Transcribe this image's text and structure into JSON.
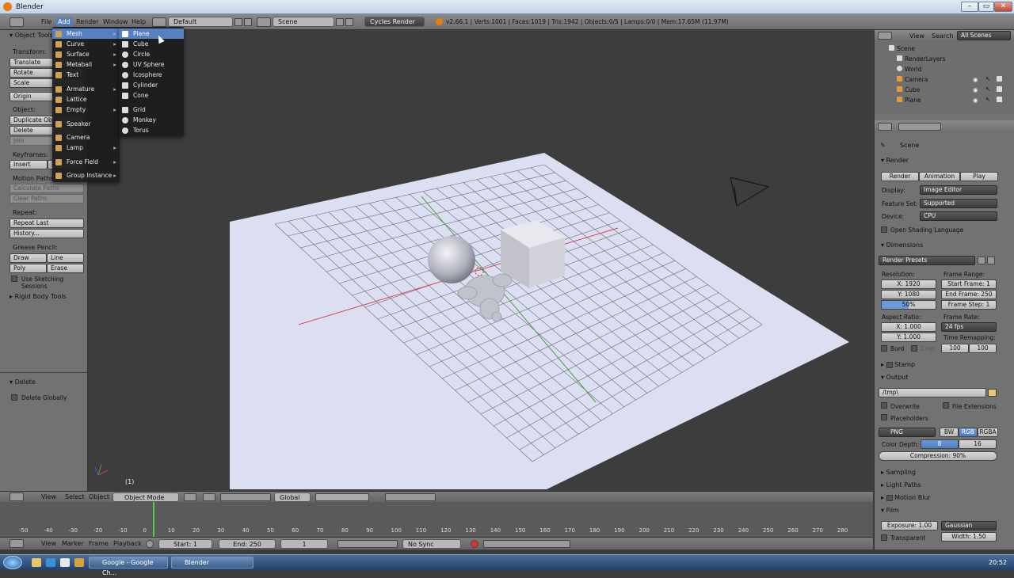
{
  "window": {
    "title": "Blender"
  },
  "topbar": {
    "menus": [
      "File",
      "Add",
      "Render",
      "Window",
      "Help"
    ],
    "layout": "Default",
    "scene": "Scene",
    "engine": "Cycles Render",
    "stats": "v2.66.1 | Verts:1001 | Faces:1019 | Tris:1942 | Objects:0/5 | Lamps:0/0 | Mem:17.65M (11.97M)"
  },
  "add_menu": {
    "items": [
      "Mesh",
      "Curve",
      "Surface",
      "Metaball",
      "Text",
      "Armature",
      "Lattice",
      "Empty",
      "Speaker",
      "Camera",
      "Lamp",
      "Force Field",
      "Group Instance"
    ]
  },
  "mesh_menu": {
    "items": [
      "Plane",
      "Cube",
      "Circle",
      "UV Sphere",
      "Icosphere",
      "Cylinder",
      "Cone",
      "Grid",
      "Monkey",
      "Torus"
    ]
  },
  "tool_shelf": {
    "header": "Object Tools",
    "transform_label": "Transform:",
    "translate": "Translate",
    "rotate": "Rotate",
    "scale": "Scale",
    "origin": "Origin",
    "object_label": "Object:",
    "duplicate": "Duplicate Objec",
    "delete": "Delete",
    "join": "Join",
    "keyframes_label": "Keyframes:",
    "insert": "Insert",
    "insert_r": "R",
    "motion_label": "Motion Paths:",
    "calc_paths": "Calculate Paths",
    "clear_paths": "Clear Paths",
    "repeat_label": "Repeat:",
    "repeat_last": "Repeat Last",
    "history": "History...",
    "grease_label": "Grease Pencil:",
    "draw": "Draw",
    "line": "Line",
    "poly": "Poly",
    "erase": "Erase",
    "sketch": "Use Sketching Sessions",
    "rigid": "Rigid Body Tools",
    "op_header": "Delete",
    "op_delete_globally": "Delete Globally"
  },
  "viewport": {
    "frame_indicator": "(1)"
  },
  "viewport_header": {
    "menus": [
      "View",
      "Select",
      "Object"
    ],
    "mode": "Object Mode",
    "orientation": "Global"
  },
  "timeline": {
    "ticks": [
      "-50",
      "-40",
      "-30",
      "-20",
      "-10",
      "0",
      "10",
      "20",
      "30",
      "40",
      "50",
      "60",
      "70",
      "80",
      "90",
      "100",
      "110",
      "120",
      "130",
      "140",
      "150",
      "160",
      "170",
      "180",
      "190",
      "200",
      "210",
      "220",
      "230",
      "240",
      "250",
      "260",
      "270",
      "280"
    ],
    "menus": [
      "View",
      "Marker",
      "Frame",
      "Playback"
    ],
    "start": "Start: 1",
    "end": "End: 250",
    "current": "1",
    "sync": "No Sync"
  },
  "outliner": {
    "menus": [
      "View",
      "Search"
    ],
    "filter": "All Scenes",
    "rows": [
      "Scene",
      "RenderLayers",
      "World",
      "Camera",
      "Cube",
      "Plane"
    ]
  },
  "properties": {
    "context": "Scene",
    "render_header": "Render",
    "render_btn": "Render",
    "animation_btn": "Animation",
    "play_btn": "Play",
    "display_label": "Display:",
    "display_value": "Image Editor",
    "feature_label": "Feature Set:",
    "feature_value": "Supported",
    "device_label": "Device:",
    "device_value": "CPU",
    "osl": "Open Shading Language",
    "dimensions_header": "Dimensions",
    "render_presets": "Render Presets",
    "resolution_label": "Resolution:",
    "res_x": "X: 1920",
    "res_y": "Y: 1080",
    "res_pct": "50%",
    "frame_range_label": "Frame Range:",
    "start_frame": "Start Frame: 1",
    "end_frame": "End Frame: 250",
    "frame_step": "Frame Step: 1",
    "aspect_label": "Aspect Ratio:",
    "aspect_x": "X: 1.000",
    "aspect_y": "Y: 1.000",
    "framerate_label": "Frame Rate:",
    "framerate": "24 fps",
    "remap_label": "Time Remapping:",
    "remap_old": "100",
    "remap_new": "100",
    "bord": "Bord",
    "crop": "Crop",
    "stamp": "Stamp",
    "output_header": "Output",
    "output_path": "/tmp\\",
    "overwrite": "Overwrite",
    "file_ext": "File Extensions",
    "placeholders": "Placeholders",
    "format": "PNG",
    "bw": "BW",
    "rgb": "RGB",
    "rgba": "RGBA",
    "color_depth_label": "Color Depth:",
    "depth_8": "8",
    "depth_16": "16",
    "compression": "Compression: 90%",
    "sampling": "Sampling",
    "light_paths": "Light Paths",
    "motion_blur": "Motion Blur",
    "film": "Film",
    "exposure": "Exposure: 1.00",
    "filter": "Gaussian",
    "transparent": "Transparent",
    "width": "Width: 1.50"
  },
  "taskbar": {
    "items": [
      "Google - Google Ch...",
      "Blender"
    ],
    "clock": "20:52"
  }
}
